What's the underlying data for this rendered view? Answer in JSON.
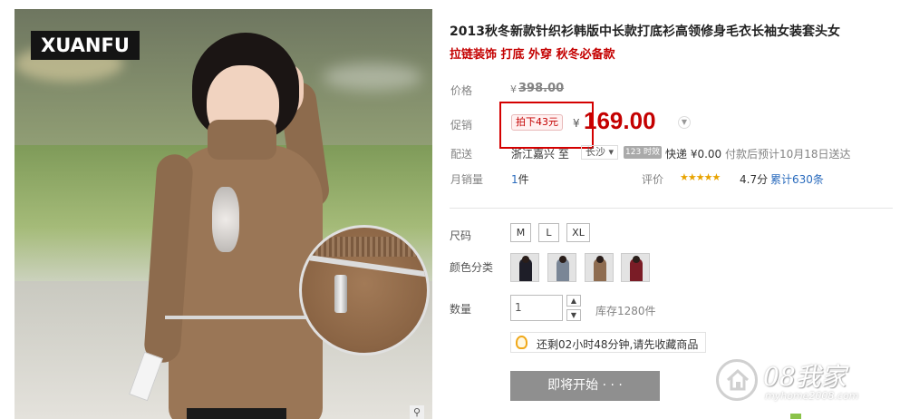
{
  "image": {
    "logo_text": "XUANFU",
    "zoom_icon": "magnifier-icon"
  },
  "product": {
    "title": "2013秋冬新款针织衫韩版中长款打底衫高领修身毛衣长袖女装套头女",
    "subtitle": "拉链装饰 打底 外穿 秋冬必备款"
  },
  "price": {
    "label": "价格",
    "currency": "¥",
    "original": "398.00"
  },
  "promo": {
    "label": "促销",
    "tag": "拍下43元",
    "currency": "¥",
    "price": "169.00",
    "price_drop_icon": "chevron-down-icon"
  },
  "shipping": {
    "label": "配送",
    "from": "浙江嘉兴 至",
    "to": "长沙",
    "badge": "123 时效",
    "express": "快递 ¥0.00",
    "estimate": "付款后预计10月18日送达"
  },
  "sales": {
    "label": "月销量",
    "count": "1",
    "unit": "件",
    "rating_label": "评价",
    "stars": "★★★★★",
    "score": "4.7分",
    "reviews": "累计630条"
  },
  "size": {
    "label": "尺码",
    "options": [
      "M",
      "L",
      "XL"
    ]
  },
  "color": {
    "label": "颜色分类"
  },
  "quantity": {
    "label": "数量",
    "value": "1",
    "up": "▲",
    "down": "▼",
    "stock": "库存1280件"
  },
  "reminder": {
    "text": "还剩02小时48分钟,请先收藏商品"
  },
  "buy": {
    "label": "即将开始 · · ·"
  },
  "watermark": {
    "brand": "08我家",
    "url": "myhome2008.com"
  },
  "colors": {
    "accent_red": "#c40000",
    "link_blue": "#2a6bbd",
    "button_gray": "#8f8f8f",
    "swatches": [
      "#1e1e28",
      "#7a8696",
      "#8e6c50",
      "#7a1c26"
    ]
  }
}
